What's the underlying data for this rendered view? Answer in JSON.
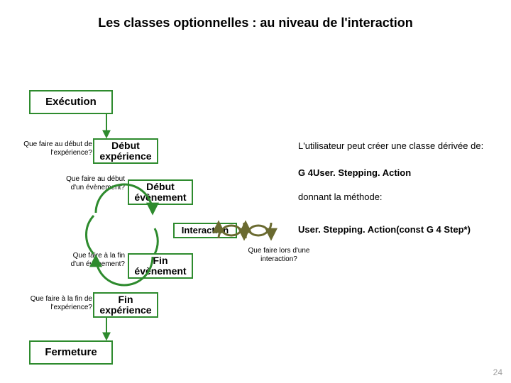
{
  "title": "Les classes optionnelles : au niveau de l'interaction",
  "boxes": {
    "execution": "Exécution",
    "debut_exp": "Début expérience",
    "debut_evt": "Début évènement",
    "interaction": "Interaction",
    "fin_evt": "Fin évènement",
    "fin_exp": "Fin expérience",
    "fermeture": "Fermeture"
  },
  "questions": {
    "q_debut_exp": "Que faire au début de l'expérience?",
    "q_debut_evt": "Que faire au début d'un évènement?",
    "q_interaction": "Que faire lors d'une interaction?",
    "q_fin_evt": "Que faire à la fin d'un évènement?",
    "q_fin_exp": "Que faire à la fin de l'expérience?"
  },
  "side": {
    "line1": "L'utilisateur peut créer une classe dérivée de:",
    "class_name": "G 4User. Stepping. Action",
    "line2": "donnant la méthode:",
    "method": "User. Stepping. Action(const G 4 Step*)"
  },
  "page": "24"
}
